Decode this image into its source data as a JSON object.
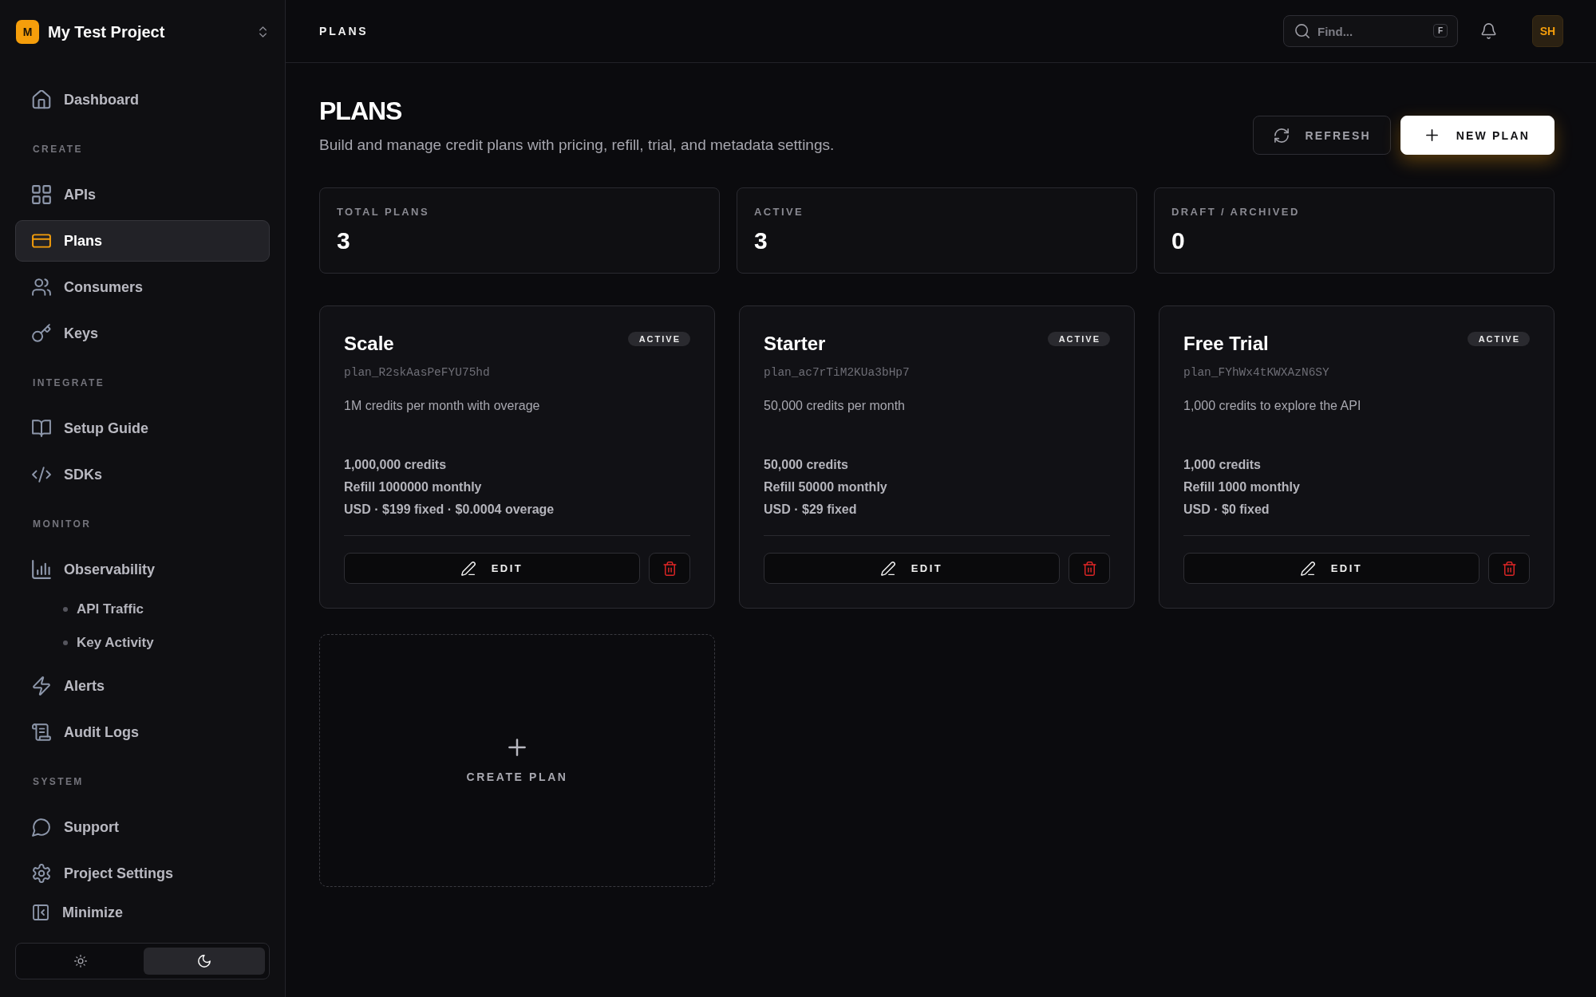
{
  "sidebar": {
    "project": {
      "badge": "M",
      "name": "My Test Project"
    },
    "sections": [
      {
        "items": [
          {
            "label": "Dashboard",
            "selected": false
          }
        ]
      },
      {
        "heading": "CREATE",
        "items": [
          {
            "label": "APIs",
            "selected": false
          },
          {
            "label": "Plans",
            "selected": true
          },
          {
            "label": "Consumers",
            "selected": false
          },
          {
            "label": "Keys",
            "selected": false
          }
        ]
      },
      {
        "heading": "INTEGRATE",
        "items": [
          {
            "label": "Setup Guide",
            "selected": false
          },
          {
            "label": "SDKs",
            "selected": false
          }
        ]
      },
      {
        "heading": "MONITOR",
        "items": [
          {
            "label": "Observability",
            "selected": false,
            "children": [
              {
                "label": "API Traffic",
                "selected": false
              },
              {
                "label": "Key Activity",
                "selected": false
              }
            ]
          },
          {
            "label": "Alerts",
            "selected": false
          },
          {
            "label": "Audit Logs",
            "selected": false
          }
        ]
      },
      {
        "heading": "SYSTEM",
        "items": [
          {
            "label": "Support",
            "selected": false
          },
          {
            "label": "Project Settings",
            "selected": false
          }
        ]
      }
    ],
    "footer": {
      "minimize": "Minimize",
      "theme_toggle": [
        {
          "kind": "light",
          "selected": false
        },
        {
          "kind": "dark",
          "selected": true
        }
      ]
    }
  },
  "topbar": {
    "title": "PLANS",
    "search": {
      "placeholder": "Find...",
      "shortcut": "F"
    },
    "avatar": "SH"
  },
  "page": {
    "title": "PLANS",
    "subtitle": "Build and manage credit plans with pricing, refill, trial, and metadata settings.",
    "actions": [
      {
        "kind": "refresh",
        "label": "REFRESH"
      },
      {
        "kind": "add",
        "label": "NEW PLAN"
      }
    ]
  },
  "stats": [
    {
      "label": "TOTAL PLANS",
      "value": "3"
    },
    {
      "label": "ACTIVE",
      "value": "3"
    },
    {
      "label": "DRAFT / ARCHIVED",
      "value": "0"
    }
  ],
  "plans": [
    {
      "name": "Scale",
      "status": "ACTIVE",
      "id": "plan_R2skAasPeFYU75hd",
      "description": "1M credits per month with overage",
      "details": [
        "1,000,000 credits",
        "Refill 1000000 monthly",
        "USD · $199 fixed · $0.0004 overage"
      ],
      "edit_label": "EDIT"
    },
    {
      "name": "Starter",
      "status": "ACTIVE",
      "id": "plan_ac7rTiM2KUa3bHp7",
      "description": "50,000 credits per month",
      "details": [
        "50,000 credits",
        "Refill 50000 monthly",
        "USD · $29 fixed"
      ],
      "edit_label": "EDIT"
    },
    {
      "name": "Free Trial",
      "status": "ACTIVE",
      "id": "plan_FYhWx4tKWXAzN6SY",
      "description": "1,000 credits to explore the API",
      "details": [
        "1,000 credits",
        "Refill 1000 monthly",
        "USD · $0 fixed"
      ],
      "edit_label": "EDIT"
    }
  ],
  "create_card": {
    "label": "CREATE PLAN"
  }
}
